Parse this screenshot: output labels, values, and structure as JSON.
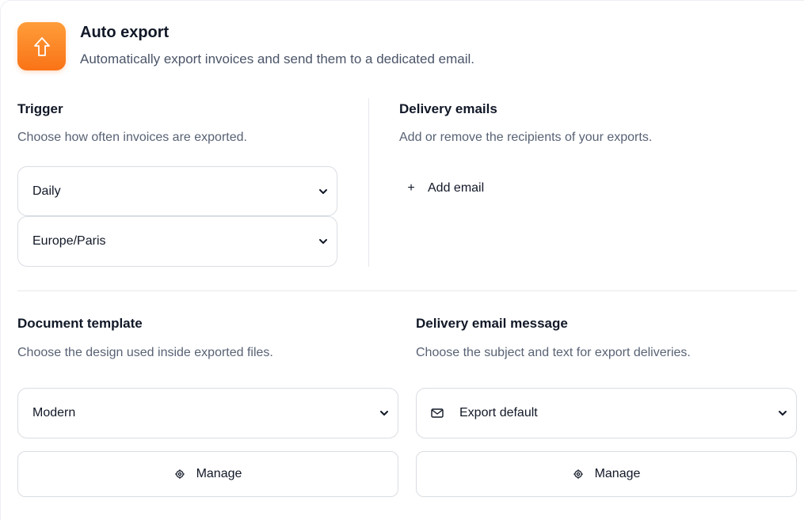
{
  "header": {
    "title": "Auto export",
    "subtitle": "Automatically export invoices and send them to a dedicated email.",
    "icon": "upload-arrow-icon",
    "accent": "#f97316"
  },
  "trigger": {
    "heading": "Trigger",
    "description": "Choose how often invoices are exported.",
    "frequency": "Daily",
    "timezone": "Europe/Paris"
  },
  "delivery_emails": {
    "heading": "Delivery emails",
    "description": "Add or remove the recipients of your exports.",
    "add_label": "Add email"
  },
  "document_template": {
    "heading": "Document template",
    "description": "Choose the design used inside exported files.",
    "selected": "Modern",
    "manage_label": "Manage"
  },
  "delivery_message": {
    "heading": "Delivery email message",
    "description": "Choose the subject and text for export deliveries.",
    "selected": "Export default",
    "manage_label": "Manage"
  }
}
